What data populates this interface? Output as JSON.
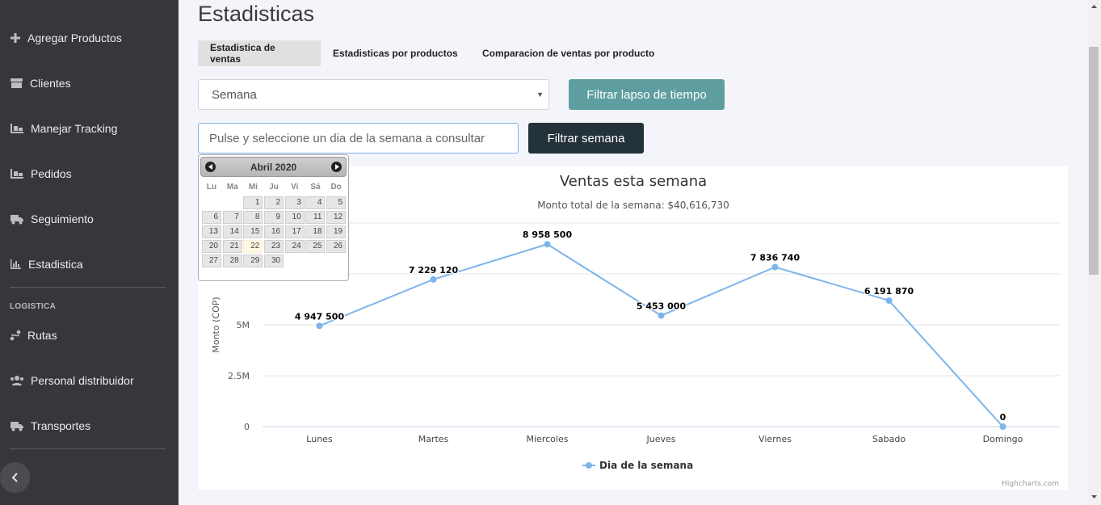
{
  "sidebar": {
    "items": [
      {
        "label": "Agregar Productos",
        "icon": "plus-icon"
      },
      {
        "label": "Clientes",
        "icon": "store-icon"
      },
      {
        "label": "Manejar Tracking",
        "icon": "truck-loading-icon"
      },
      {
        "label": "Pedidos",
        "icon": "truck-loading-icon"
      },
      {
        "label": "Seguimiento",
        "icon": "truck-icon"
      },
      {
        "label": "Estadistica",
        "icon": "chart-bar-icon"
      }
    ],
    "section_label": "LOGISTICA",
    "logistics_items": [
      {
        "label": "Rutas",
        "icon": "route-icon"
      },
      {
        "label": "Personal distribuidor",
        "icon": "users-icon"
      },
      {
        "label": "Transportes",
        "icon": "truck-icon"
      }
    ],
    "collapse_icon": "chevron-left-icon"
  },
  "page": {
    "title": "Estadisticas"
  },
  "tabs": [
    {
      "label": "Estadistica de ventas",
      "active": true
    },
    {
      "label": "Estadisticas por productos",
      "active": false
    },
    {
      "label": "Comparacion de ventas por producto",
      "active": false
    }
  ],
  "filters": {
    "period_select": {
      "value": "Semana"
    },
    "filter_period_button": "Filtrar lapso de tiempo",
    "date_input": {
      "placeholder": "Pulse y seleccione un dia de la semana a consultar"
    },
    "filter_week_button": "Filtrar semana"
  },
  "datepicker": {
    "title": "Abril 2020",
    "weekdays": [
      "Lu",
      "Ma",
      "Mi",
      "Ju",
      "Vi",
      "Sá",
      "Do"
    ],
    "leading_blanks": 2,
    "days": [
      "1",
      "2",
      "3",
      "4",
      "5",
      "6",
      "7",
      "8",
      "9",
      "10",
      "11",
      "12",
      "13",
      "14",
      "15",
      "16",
      "17",
      "18",
      "19",
      "20",
      "21",
      "22",
      "23",
      "24",
      "25",
      "26",
      "27",
      "28",
      "29",
      "30"
    ],
    "highlighted_day": "22"
  },
  "chart_data": {
    "type": "line",
    "title": "Ventas esta semana",
    "subtitle": "Monto total de la semana: $40,616,730",
    "ylabel": "Monto (COP)",
    "categories": [
      "Lunes",
      "Martes",
      "Miercoles",
      "Jueves",
      "Viernes",
      "Sabado",
      "Domingo"
    ],
    "series": [
      {
        "name": "Dia de la semana",
        "values": [
          4947500,
          7229120,
          8958500,
          5453000,
          7836740,
          6191870,
          0
        ],
        "color": "#7cb5ec"
      }
    ],
    "data_labels": [
      "4 947 500",
      "7 229 120",
      "8 958 500",
      "5 453 000",
      "7 836 740",
      "6 191 870",
      "0"
    ],
    "yticks": [
      {
        "value": 0,
        "label": "0"
      },
      {
        "value": 2500000,
        "label": "2.5M"
      },
      {
        "value": 5000000,
        "label": "5M"
      },
      {
        "value": 7500000,
        "label": ""
      },
      {
        "value": 10000000,
        "label": ""
      }
    ],
    "ylim": [
      0,
      10000000
    ],
    "grid": true,
    "legend_position": "bottom-center",
    "credits": "Highcharts.com"
  }
}
